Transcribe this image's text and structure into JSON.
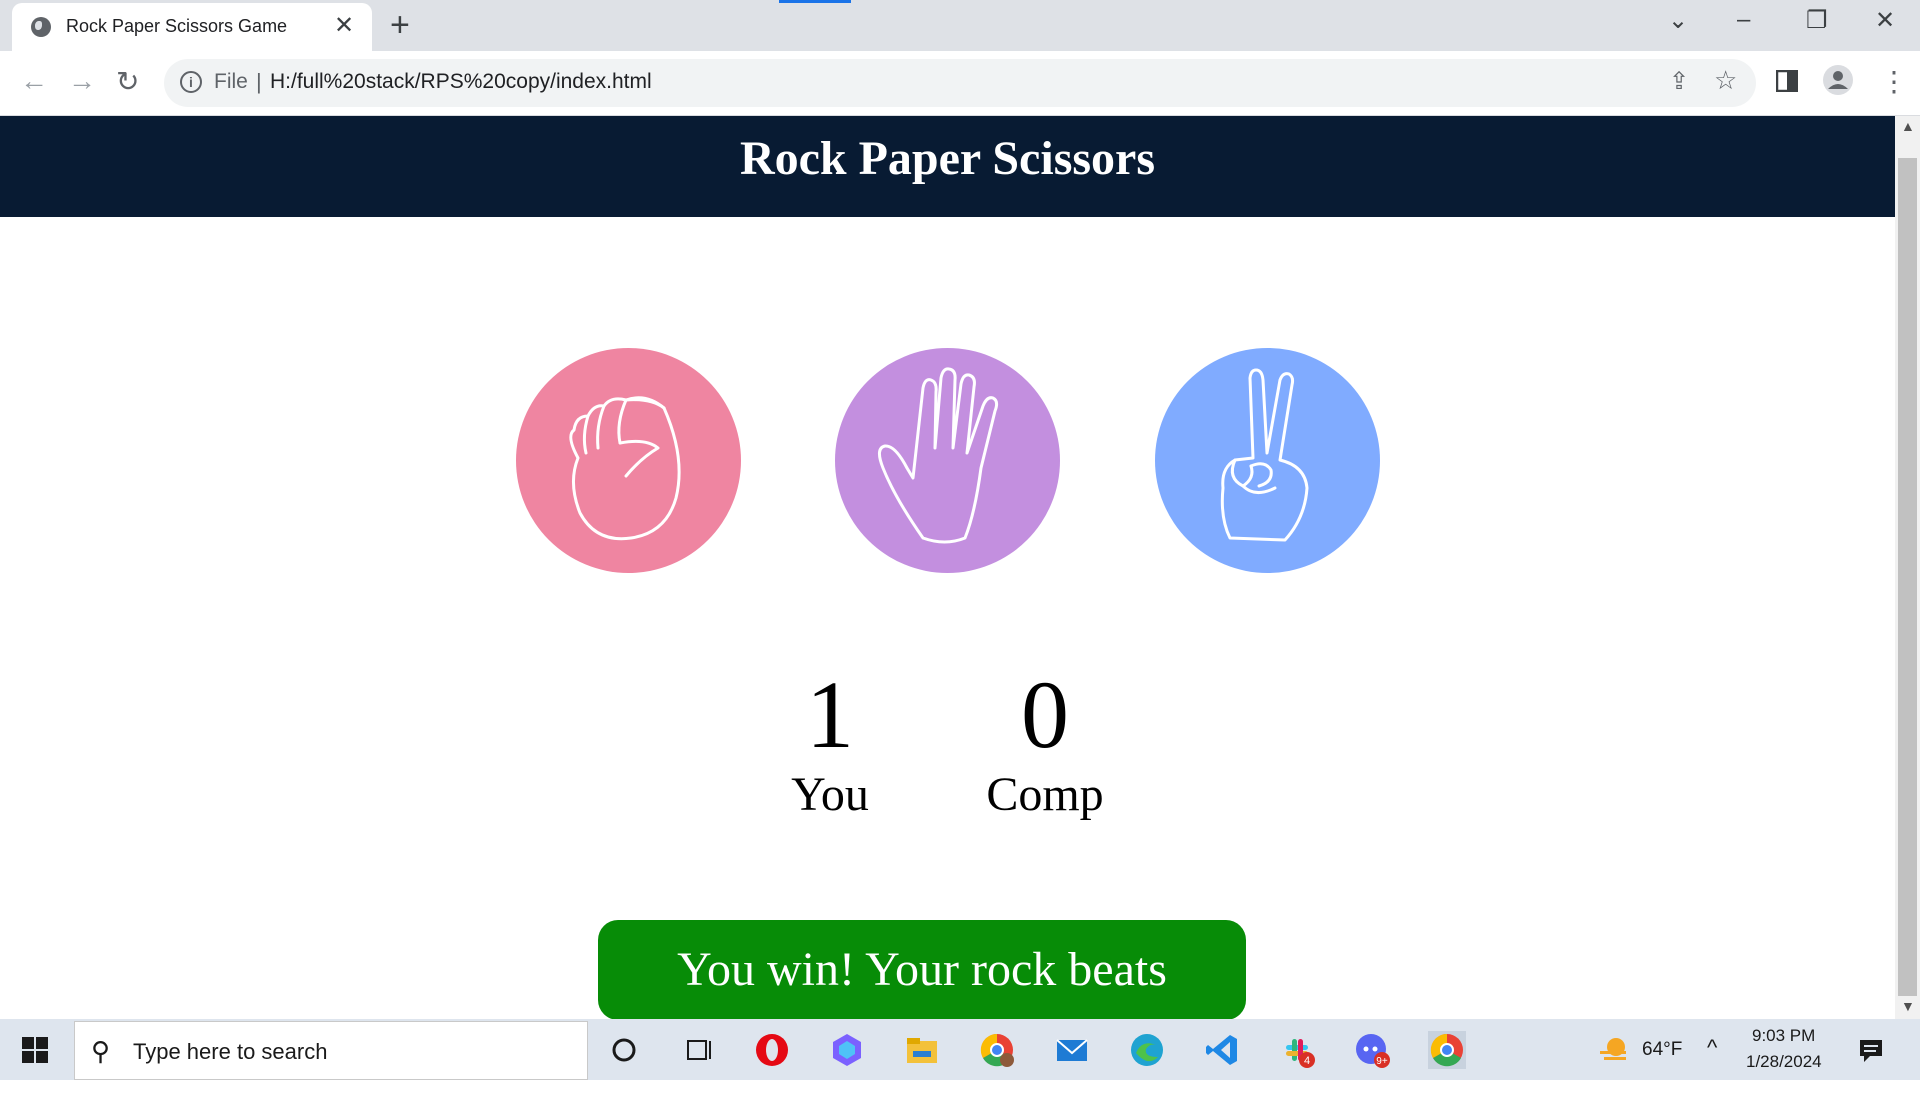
{
  "browser": {
    "tab_title": "Rock Paper Scissors Game",
    "file_label": "File",
    "url": "H:/full%20stack/RPS%20copy/index.html"
  },
  "page": {
    "title": "Rock Paper Scissors",
    "choices": [
      {
        "id": "rock",
        "color": "#ef85a1"
      },
      {
        "id": "paper",
        "color": "#c38fdf"
      },
      {
        "id": "scissors",
        "color": "#80abff"
      }
    ],
    "score": {
      "user_score": "1",
      "user_label": "You",
      "comp_score": "0",
      "comp_label": "Comp"
    },
    "message": "You win! Your rock beats scissors",
    "message_color": "#078c07",
    "header_color": "#081b33"
  },
  "taskbar": {
    "search_placeholder": "Type here to search",
    "temperature": "64°F",
    "time": "9:03 PM",
    "date": "1/28/2024",
    "slack_badge": "4",
    "discord_badge": "9+"
  }
}
